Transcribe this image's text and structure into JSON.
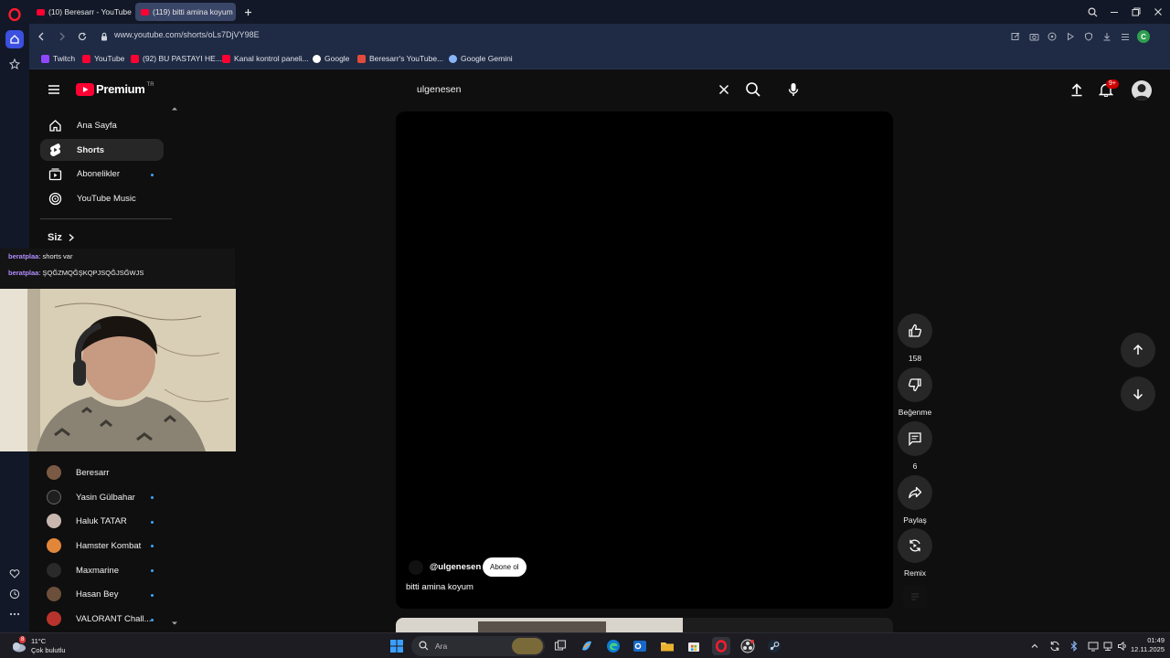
{
  "browser": {
    "tabs": [
      {
        "label": "(10) Beresarr - YouTube",
        "active": false
      },
      {
        "label": "(119) bitti amina koyum",
        "active": true
      }
    ],
    "url": "www.youtube.com/shorts/oLs7DjVY98E",
    "profile_initial": "C"
  },
  "bookmarks": [
    {
      "label": "Twitch",
      "color": "#9146ff"
    },
    {
      "label": "YouTube",
      "color": "#ff0033"
    },
    {
      "label": "(92) BU PASTAYI HE...",
      "color": "#ff0033"
    },
    {
      "label": "Kanal kontrol paneli...",
      "color": "#ff0033"
    },
    {
      "label": "Google",
      "color": "#ffffff"
    },
    {
      "label": "Beresarr's YouTube...",
      "color": "#e24b3b"
    },
    {
      "label": "Google Gemini",
      "color": "#8ab4f8"
    }
  ],
  "youtube": {
    "logo": "Premium",
    "logo_suffix": "TR",
    "search_query": "ulgenesen",
    "notification_badge": "9+",
    "nav": [
      {
        "label": "Ana Sayfa",
        "icon": "home-icon"
      },
      {
        "label": "Shorts",
        "icon": "shorts-icon"
      },
      {
        "label": "Abonelikler",
        "icon": "subscriptions-icon"
      },
      {
        "label": "YouTube Music",
        "icon": "music-icon"
      }
    ],
    "you_section": "Siz",
    "subscriptions": [
      {
        "label": "Beresarr",
        "color": "#7a5a44"
      },
      {
        "label": "Yasin Gülbahar",
        "color": "#1f1f1f"
      },
      {
        "label": "Haluk TATAR",
        "color": "#c9b8b0"
      },
      {
        "label": "Hamster Kombat",
        "color": "#e2873a"
      },
      {
        "label": "Maxmarine",
        "color": "#2a2a2a"
      },
      {
        "label": "Hasan Bey",
        "color": "#6b4f3a"
      },
      {
        "label": "VALORANT Chall...",
        "color": "#b8332d"
      }
    ]
  },
  "chat": [
    {
      "user": "beratplaa",
      "message": ": shorts var"
    },
    {
      "user": "beratplaa",
      "message": ": ŞQĞZMQĞŞKQPJSQĞJSĞWJS"
    }
  ],
  "short": {
    "channel": "@ulgenesen",
    "subscribe_label": "Abone ol",
    "title": "bitti amina koyum",
    "likes": "158",
    "dislike_label": "Beğenme",
    "comments": "6",
    "share_label": "Paylaş",
    "remix_label": "Remix"
  },
  "taskbar": {
    "weather_temp": "11°C",
    "weather_desc": "Çok bulutlu",
    "weather_badge": "8",
    "search_placeholder": "Ara",
    "time": "01:49",
    "date": "12.11.2025"
  }
}
